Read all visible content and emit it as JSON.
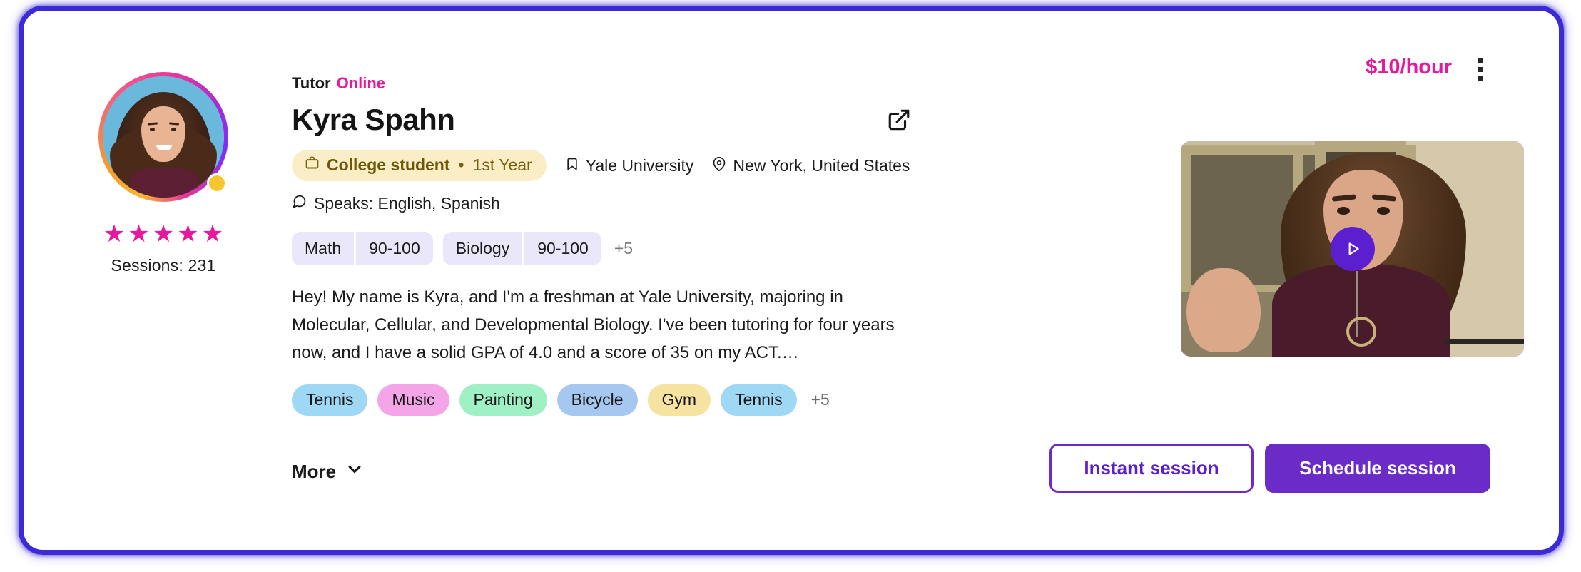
{
  "card": {
    "role_label": "Tutor",
    "status_label": "Online",
    "tutor_name": "Kyra Spahn",
    "price": "$10/hour",
    "external_link_icon": "external-link-icon",
    "kebab_icon": "more-vertical-icon"
  },
  "profile": {
    "stars": [
      "★",
      "★",
      "★",
      "★",
      "★"
    ],
    "sessions_label": "Sessions: 231",
    "online_dot_color": "#f7c52d",
    "avatar_ring_colors": [
      "#f7b733",
      "#e8369c",
      "#7b2ff7"
    ]
  },
  "meta": {
    "education_icon": "briefcase-icon",
    "education_level": "College student",
    "education_separator": "•",
    "education_year": "1st Year",
    "school_icon": "bookmark-icon",
    "school": "Yale University",
    "location_icon": "map-pin-icon",
    "location": "New York, United States",
    "speaks_icon": "chat-bubble-icon",
    "speaks": "Speaks: English, Spanish"
  },
  "subjects": {
    "items": [
      {
        "name": "Math",
        "grade": "90-100"
      },
      {
        "name": "Biology",
        "grade": "90-100"
      }
    ],
    "overflow": "+5"
  },
  "bio": {
    "text": "Hey! My name is Kyra, and I'm a freshman at Yale University, majoring in Molecular, Cellular, and Developmental Biology. I've been tutoring for four years now, and I have a solid GPA of 4.0 and a score of 35 on my ACT.…"
  },
  "interests": {
    "items": [
      {
        "label": "Tennis",
        "color": "#9ed8f5"
      },
      {
        "label": "Music",
        "color": "#f4a5e8"
      },
      {
        "label": "Painting",
        "color": "#9ff0c4"
      },
      {
        "label": "Bicycle",
        "color": "#a6c8f0"
      },
      {
        "label": "Gym",
        "color": "#f6e3a0"
      },
      {
        "label": "Tennis",
        "color": "#9ed8f5"
      }
    ],
    "overflow": "+5"
  },
  "more": {
    "label": "More",
    "icon": "chevron-down-icon"
  },
  "video": {
    "play_icon": "play-icon"
  },
  "actions": {
    "instant_label": "Instant session",
    "schedule_label": "Schedule session",
    "accent_color": "#6a2bc6"
  }
}
